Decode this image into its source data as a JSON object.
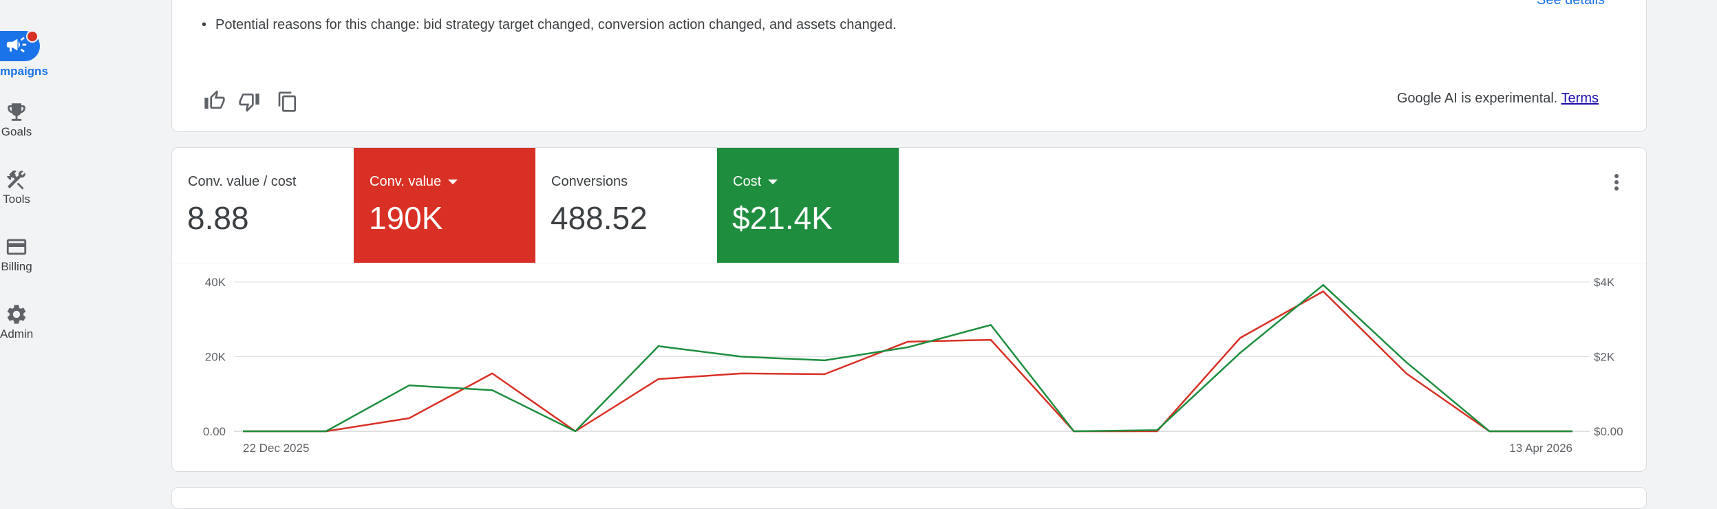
{
  "nav": {
    "items": [
      {
        "label": "mpaigns",
        "icon": "megaphone-icon",
        "active": true
      },
      {
        "label": "Goals",
        "icon": "trophy-icon"
      },
      {
        "label": "Tools",
        "icon": "tools-icon"
      },
      {
        "label": "Billing",
        "icon": "credit-card-icon"
      },
      {
        "label": "Admin",
        "icon": "gear-icon"
      }
    ]
  },
  "insight": {
    "bullet": "Potential reasons for this change: bid strategy target changed, conversion action changed, and assets changed.",
    "see_details": "See details",
    "ai_note": "Google AI is experimental.",
    "terms": "Terms",
    "icons": [
      "thumbs-up-icon",
      "thumbs-down-icon",
      "copy-icon"
    ]
  },
  "metrics": [
    {
      "label": "Conv. value / cost",
      "value": "8.88",
      "selected": false
    },
    {
      "label": "Conv. value",
      "value": "190K",
      "selected": true,
      "color": "#d93025"
    },
    {
      "label": "Conversions",
      "value": "488.52",
      "selected": false
    },
    {
      "label": "Cost",
      "value": "$21.4K",
      "selected": true,
      "color": "#1e8e3e"
    }
  ],
  "chart_data": {
    "type": "line",
    "x_labels": [
      "22 Dec 2025",
      "13 Apr 2026"
    ],
    "left_axis": {
      "ticks": [
        "0.00",
        "20K",
        "40K"
      ],
      "ylim": [
        0,
        40000
      ]
    },
    "right_axis": {
      "ticks": [
        "$0.00",
        "$2K",
        "$4K"
      ],
      "ylim": [
        0,
        4000
      ]
    },
    "series": [
      {
        "name": "Conv. value",
        "axis": "left",
        "color": "#d93025",
        "values": [
          0,
          0,
          3500,
          15500,
          0,
          14000,
          15500,
          15300,
          24000,
          24500,
          0,
          0,
          25000,
          37500,
          15500,
          0,
          0
        ]
      },
      {
        "name": "Cost",
        "axis": "right",
        "color": "#1e8e3e",
        "values": [
          0,
          0,
          1230,
          1100,
          0,
          2280,
          2000,
          1900,
          2250,
          2850,
          0,
          30,
          2100,
          3920,
          1850,
          0,
          0
        ]
      }
    ]
  }
}
